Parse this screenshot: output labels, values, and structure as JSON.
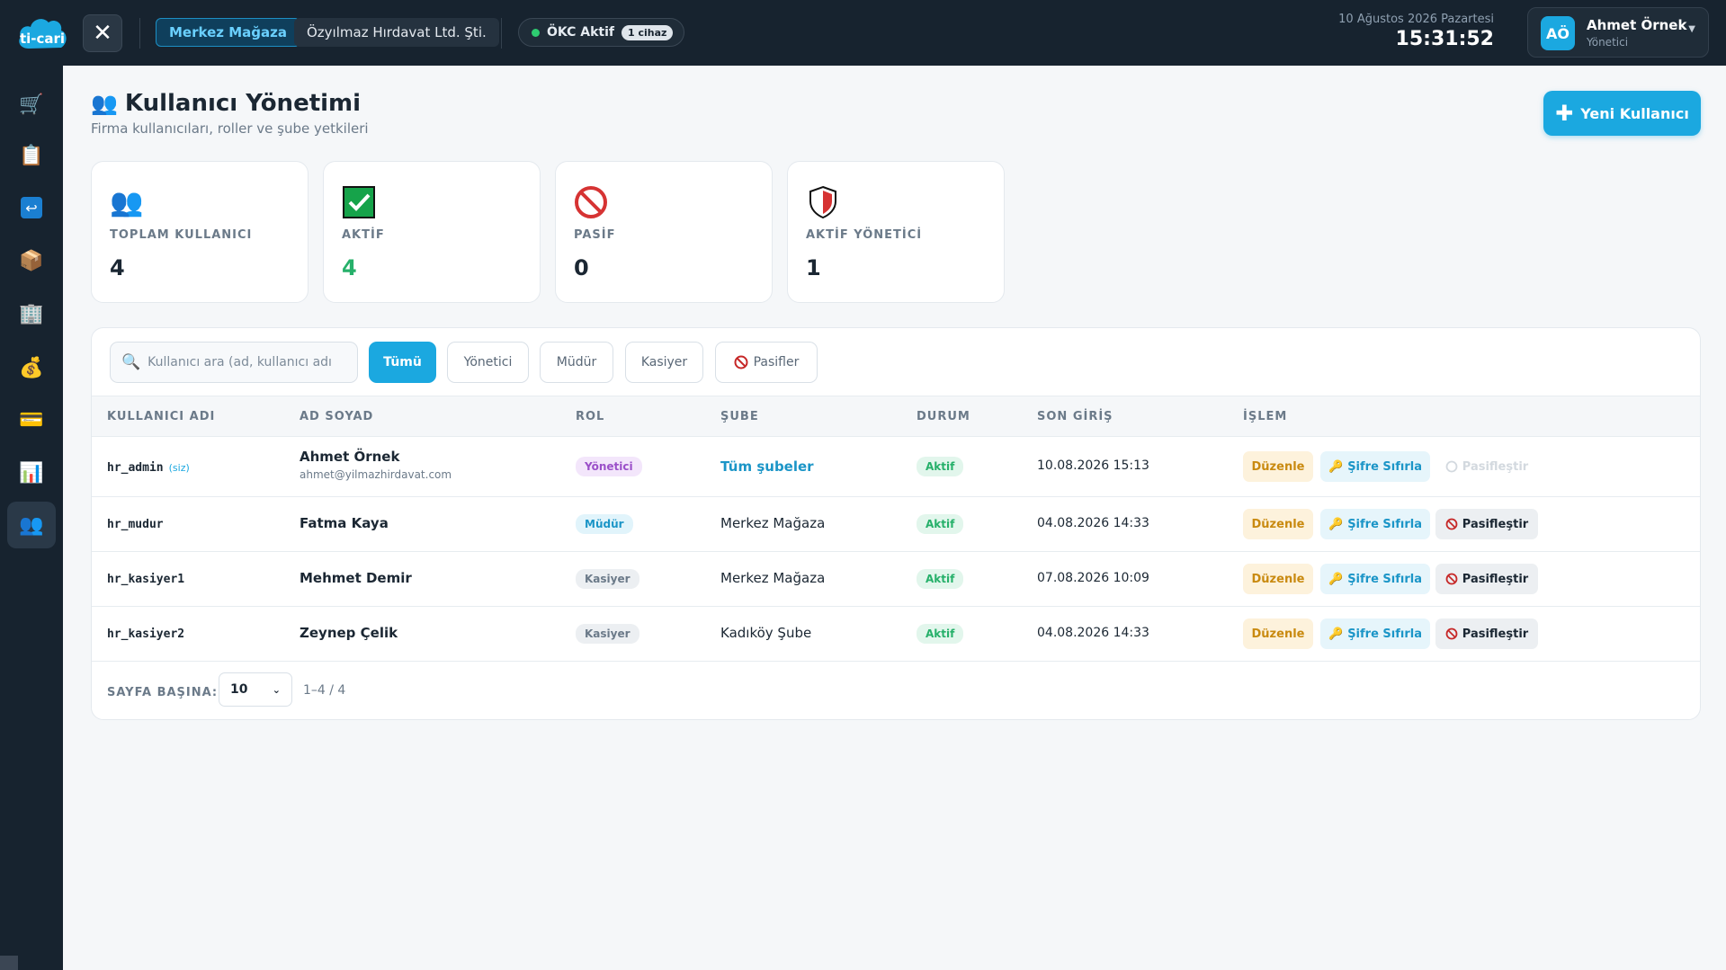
{
  "header": {
    "logo_text": "ti-cari",
    "store": "Merkez Mağaza",
    "company": "Özyılmaz Hırdavat Ltd. Şti.",
    "okc_status": "ÖKC Aktif",
    "okc_count": "1 cihaz",
    "date": "10 Ağustos 2026 Pazartesi",
    "time": "15:31:52",
    "user_initials": "AÖ",
    "user_name": "Ahmet Örnek",
    "user_role": "Yönetici"
  },
  "sidebar": {
    "items": [
      {
        "icon": "shopping-cart-icon",
        "glyph": "🛒"
      },
      {
        "icon": "clipboard-icon",
        "glyph": "📋"
      },
      {
        "icon": "return-icon",
        "glyph": "↩"
      },
      {
        "icon": "package-icon",
        "glyph": "📦"
      },
      {
        "icon": "building-icon",
        "glyph": "🏢"
      },
      {
        "icon": "money-bag-icon",
        "glyph": "💰"
      },
      {
        "icon": "credit-card-icon",
        "glyph": "💳"
      },
      {
        "icon": "bar-chart-icon",
        "glyph": "📊"
      },
      {
        "icon": "users-icon",
        "glyph": "👥"
      }
    ]
  },
  "page": {
    "title": "Kullanıcı Yönetimi",
    "subtitle": "Firma kullanıcıları, roller ve şube yetkileri",
    "new_user_label": "Yeni Kullanıcı"
  },
  "stats": [
    {
      "label": "TOPLAM KULLANICI",
      "value": "4",
      "icon": "users-icon"
    },
    {
      "label": "AKTİF",
      "value": "4",
      "icon": "check-box-icon"
    },
    {
      "label": "PASİF",
      "value": "0",
      "icon": "prohibited-icon"
    },
    {
      "label": "AKTİF YÖNETİCİ",
      "value": "1",
      "icon": "shield-icon"
    }
  ],
  "filters": {
    "search_placeholder": "Kullanıcı ara (ad, kullanıcı adı",
    "all": "Tümü",
    "yonetici": "Yönetici",
    "mudur": "Müdür",
    "kasiyer": "Kasiyer",
    "pasifler": "Pasifler"
  },
  "table": {
    "headers": [
      "KULLANICI ADI",
      "AD SOYAD",
      "ROL",
      "ŞUBE",
      "DURUM",
      "SON GİRİŞ",
      "İŞLEM"
    ],
    "rows": [
      {
        "username": "hr_admin",
        "self": "(siz)",
        "name": "Ahmet Örnek",
        "email": "ahmet@yilmazhirdavat.com",
        "role": "Yönetici",
        "branch": "Tüm şubeler",
        "status": "Aktif",
        "last_login": "10.08.2026 15:13"
      },
      {
        "username": "hr_mudur",
        "name": "Fatma Kaya",
        "role": "Müdür",
        "branch": "Merkez Mağaza",
        "status": "Aktif",
        "last_login": "04.08.2026 14:33"
      },
      {
        "username": "hr_kasiyer1",
        "name": "Mehmet Demir",
        "role": "Kasiyer",
        "branch": "Merkez Mağaza",
        "status": "Aktif",
        "last_login": "07.08.2026 10:09"
      },
      {
        "username": "hr_kasiyer2",
        "name": "Zeynep Çelik",
        "role": "Kasiyer",
        "branch": "Kadıköy Şube",
        "status": "Aktif",
        "last_login": "04.08.2026 14:33"
      }
    ],
    "actions": {
      "edit": "Düzenle",
      "reset": "Şifre Sıfırla",
      "deactivate": "Pasifleştir"
    }
  },
  "pagination": {
    "per_page_label": "SAYFA BAŞINA:",
    "per_page": "10",
    "range": "1–4 / 4"
  },
  "colors": {
    "accent": "#1ba8e0",
    "success": "#26b06a",
    "topbar": "#17232f"
  }
}
